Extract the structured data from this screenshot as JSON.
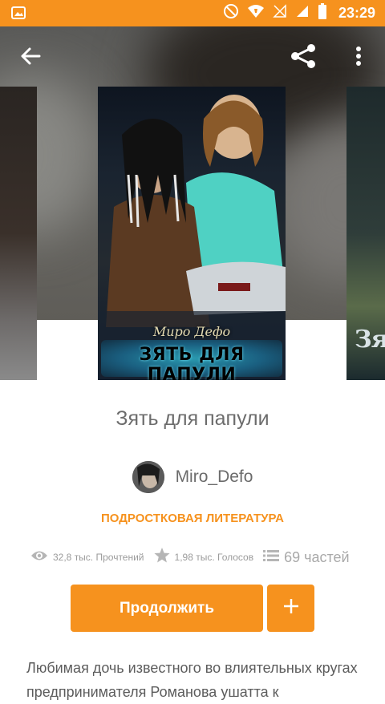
{
  "status_bar": {
    "time": "23:29"
  },
  "book": {
    "title": "Зять для папули",
    "author": "Miro_Defo",
    "genre": "ПОДРОСТКОВАЯ ЛИТЕРАТУРА",
    "cover": {
      "author_text": "Миро Дефо",
      "title_text": "ЗЯТЬ ДЛЯ ПАПУЛИ"
    },
    "right_cover_text": "Зя"
  },
  "stats": {
    "reads": "32,8 тыс. Прочтений",
    "votes": "1,98 тыс. Голосов",
    "parts": "69 частей"
  },
  "actions": {
    "continue_label": "Продолжить",
    "add_label": "+"
  },
  "description": "Любимая дочь известного во влиятельных кругах предпринимателя Романова ушатта к",
  "icons": [
    "image-icon",
    "no-disturb-icon",
    "wifi-icon",
    "signal-icon",
    "battery-icon",
    "back-arrow-icon",
    "share-icon",
    "more-icon",
    "eye-icon",
    "star-icon",
    "list-icon",
    "plus-icon"
  ],
  "colors": {
    "accent": "#f6921e",
    "text": "#6c6c6c",
    "stat": "#9b9b9b"
  }
}
